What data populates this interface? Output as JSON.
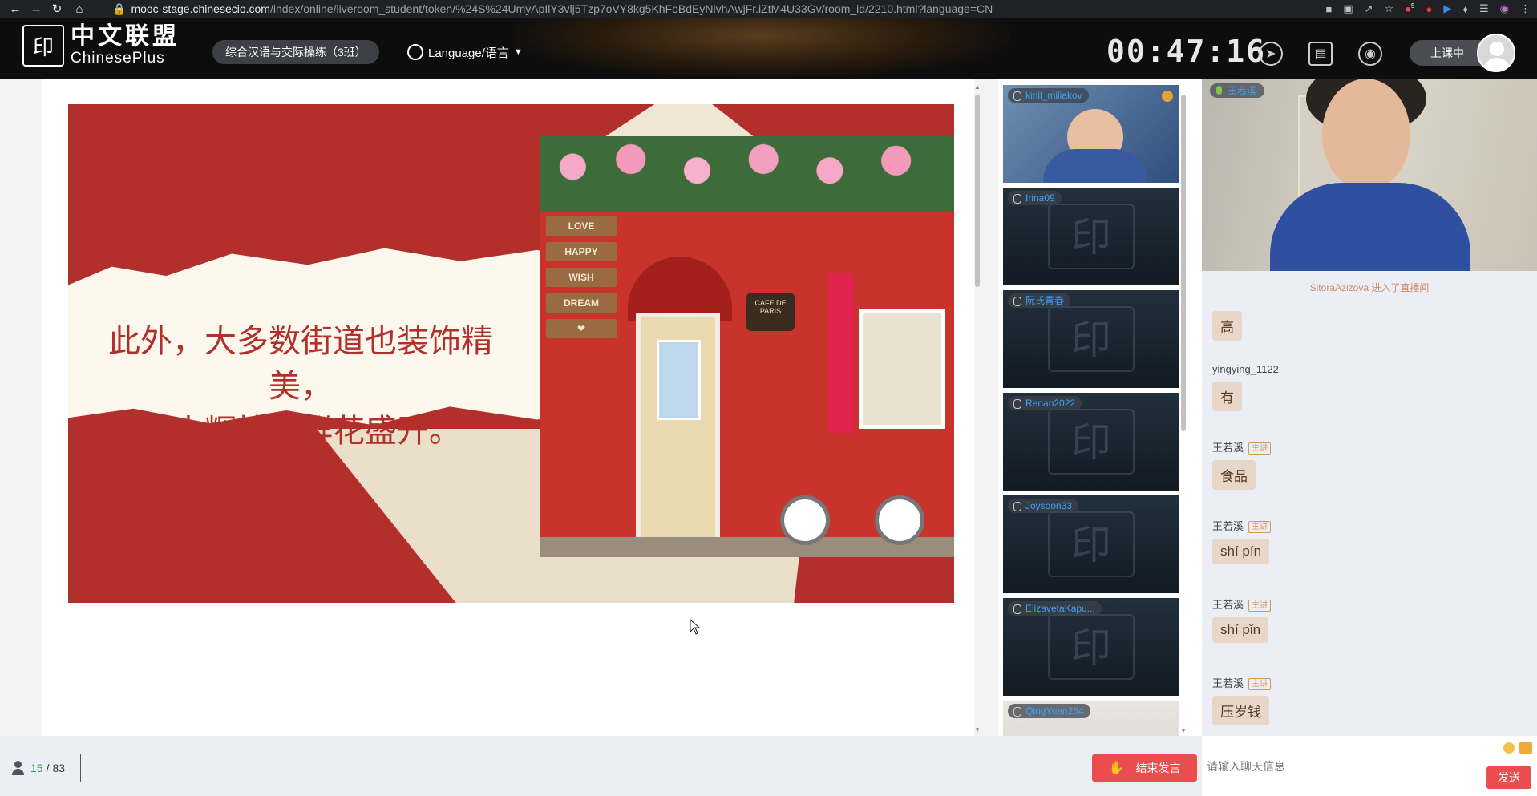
{
  "browser": {
    "url_host": "mooc-stage.chinesecio.com",
    "url_path": "/index/online/liveroom_student/token/%24S%24UmyApIlY3vlj5Tzp7oVY8kg5KhFoBdEyNivhAwjFr.iZtM4U33Gv/room_id/2210.html?language=CN",
    "ext_badge": "5"
  },
  "header": {
    "logo_cn": "中文联盟",
    "logo_en": "ChinesePlus",
    "class_name": "综合汉语与交际操练（3班）",
    "language_label": "Language/语言",
    "timer": "00:47:16",
    "live_label": "上课中"
  },
  "slide": {
    "line1": "此外，大多数街道也装饰精美，",
    "line2": "灯火辉煌，鲜花盛开。",
    "signs": [
      "LOVE",
      "HAPPY",
      "WISH",
      "DREAM"
    ],
    "plaque": "CAFE DE PARIS"
  },
  "participants": [
    {
      "name": "kirill_miliakov"
    },
    {
      "name": "Irina09"
    },
    {
      "name": "阮氏青春"
    },
    {
      "name": "Renan2022"
    },
    {
      "name": "Joysoon33"
    },
    {
      "name": "ElizavetaKapu..."
    },
    {
      "name": "QingYuan264"
    }
  ],
  "teacher": {
    "name": "王若溪"
  },
  "chat": {
    "join_note": "SitoraAzizova 进入了直播间",
    "messages": [
      {
        "user": "",
        "badge": "",
        "text": "高"
      },
      {
        "user": "yingying_1122",
        "badge": "",
        "text": "有"
      },
      {
        "user": "王若溪",
        "badge": "主讲",
        "text": "食品"
      },
      {
        "user": "王若溪",
        "badge": "主讲",
        "text": "shí pín"
      },
      {
        "user": "王若溪",
        "badge": "主讲",
        "text": "shí pǐn"
      },
      {
        "user": "王若溪",
        "badge": "主讲",
        "text": "压岁钱"
      }
    ],
    "input_placeholder": "请输入聊天信息",
    "send_label": "发送"
  },
  "bottom": {
    "online_count": "15",
    "count_sep": "/",
    "total_count": "83",
    "end_speak_label": "结束发言"
  }
}
